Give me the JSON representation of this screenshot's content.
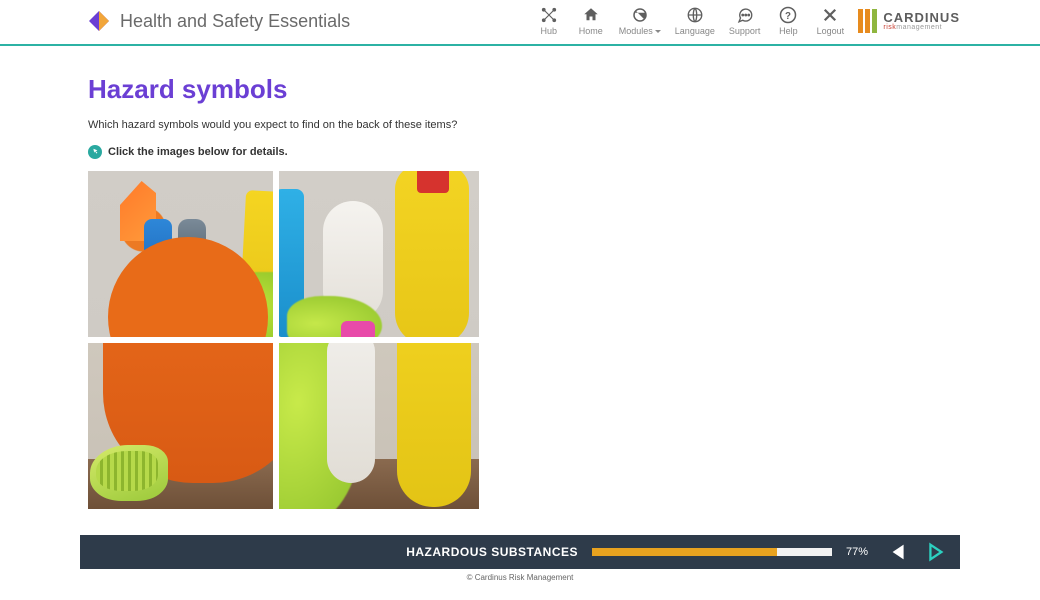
{
  "header": {
    "title": "Health and Safety Essentials",
    "nav": [
      {
        "label": "Hub"
      },
      {
        "label": "Home"
      },
      {
        "label": "Modules",
        "dropdown": true
      },
      {
        "label": "Language"
      },
      {
        "label": "Support"
      },
      {
        "label": "Help"
      },
      {
        "label": "Logout"
      }
    ],
    "brand_name": "CARDINUS",
    "brand_sub_prefix": "risk",
    "brand_sub_rest": "management"
  },
  "page": {
    "title": "Hazard symbols",
    "question": "Which hazard symbols would you expect to find on the back of these items?",
    "instruction": "Click the images below for details."
  },
  "footer": {
    "module": "HAZARDOUS SUBSTANCES",
    "progress_pct": 77,
    "progress_label": "77%",
    "copyright": "© Cardinus Risk Management"
  },
  "colors": {
    "accent": "#6b3fd4",
    "teal": "#2cb2a4",
    "progress": "#e8a21f",
    "footer_bg": "#2e3b4a"
  }
}
